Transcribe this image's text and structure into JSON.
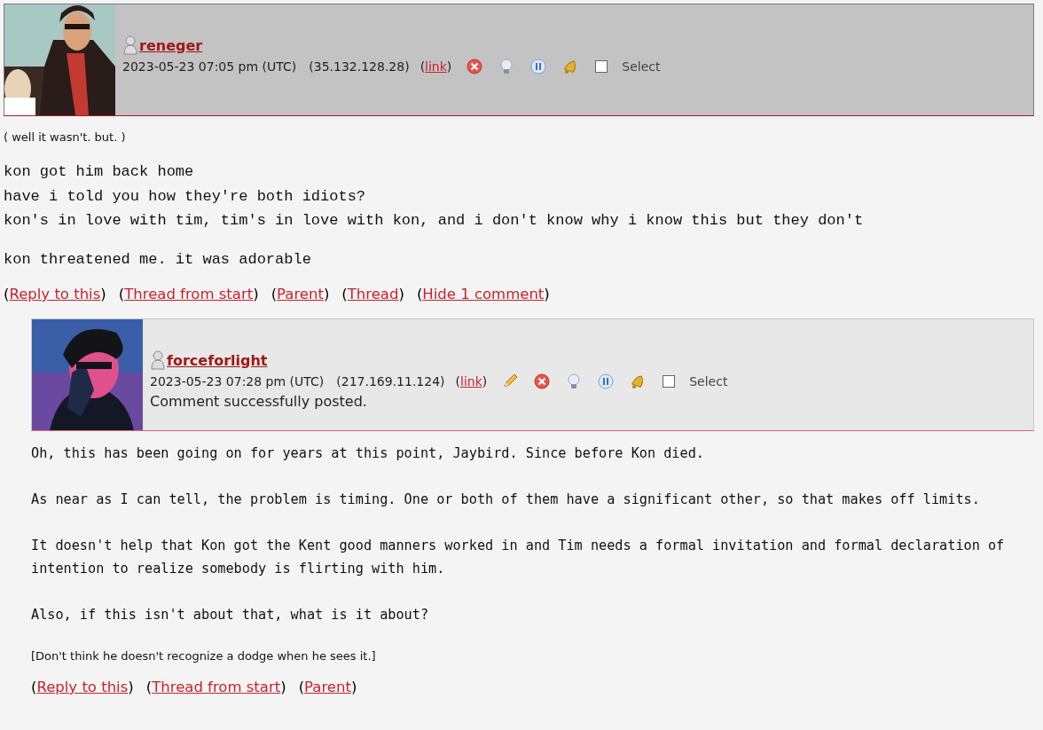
{
  "comments": [
    {
      "username": "reneger",
      "date": "2023-05-23 07:05 pm (UTC)",
      "ip": "(35.132.128.28)",
      "permalink": {
        "open": "(",
        "label": "link",
        "close": ")"
      },
      "actions": [
        {
          "kind": "delete"
        },
        {
          "kind": "screen"
        },
        {
          "kind": "freeze"
        },
        {
          "kind": "track"
        }
      ],
      "select": {
        "label": "Select",
        "checked": false
      },
      "body": [
        {
          "kind": "small",
          "text": "( well it wasn't. but. )"
        },
        {
          "kind": "typewriter",
          "lines": [
            "kon got him back home",
            "have i told you how they're both idiots?",
            "kon's in love with tim, tim's in love with kon, and i don't know why i know this but they don't"
          ]
        },
        {
          "kind": "typewriter",
          "lines": [
            "kon threatened me. it was adorable"
          ]
        }
      ],
      "links": [
        {
          "open": "(",
          "label": "Reply to this",
          "close": ")"
        },
        {
          "open": "(",
          "label": "Thread from start",
          "close": ")"
        },
        {
          "open": "(",
          "label": "Parent",
          "close": ")"
        },
        {
          "open": "(",
          "label": "Thread",
          "close": ")"
        },
        {
          "open": "(",
          "label": "Hide 1 comment",
          "close": ")"
        }
      ],
      "children": [
        {
          "username": "forceforlight",
          "date": "2023-05-23 07:28 pm (UTC)",
          "ip": "(217.169.11.124)",
          "permalink": {
            "open": "(",
            "label": "link",
            "close": ")"
          },
          "actions": [
            {
              "kind": "edit"
            },
            {
              "kind": "delete"
            },
            {
              "kind": "screen"
            },
            {
              "kind": "freeze"
            },
            {
              "kind": "track"
            }
          ],
          "select": {
            "label": "Select",
            "checked": false
          },
          "status": "Comment successfully posted.",
          "body": [
            {
              "kind": "mono",
              "text": "Oh, this has been going on for years at this point, Jaybird. Since before Kon died."
            },
            {
              "kind": "mono",
              "text": "As near as I can tell, the problem is timing. One or both of them have a significant other, so that makes off limits."
            },
            {
              "kind": "mono",
              "text": "It doesn't help that Kon got the Kent good manners worked in and Tim needs a formal invitation and formal declaration of intention to realize somebody is flirting with him."
            },
            {
              "kind": "mono",
              "text": "Also, if this isn't about that, what is it about?"
            },
            {
              "kind": "small",
              "text": "[Don't think he doesn't recognize a dodge when he sees it.]"
            }
          ],
          "links": [
            {
              "open": "(",
              "label": "Reply to this",
              "close": ")"
            },
            {
              "open": "(",
              "label": "Thread from start",
              "close": ")"
            },
            {
              "open": "(",
              "label": "Parent",
              "close": ")"
            }
          ]
        }
      ]
    }
  ]
}
